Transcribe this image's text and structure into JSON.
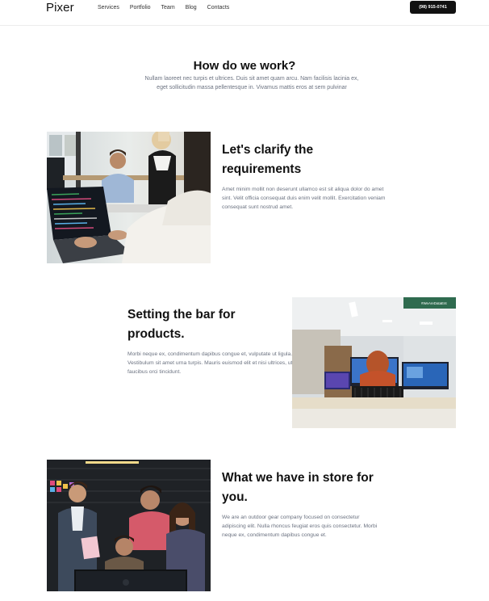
{
  "nav": {
    "logo": "Pixer",
    "links": [
      "Services",
      "Portfolio",
      "Team",
      "Blog",
      "Contacts"
    ],
    "phone": "(98) 915-0741"
  },
  "hero": {
    "title": "How do we work?",
    "subtitle": "Nullam laoreet nec turpis et ultrices. Duis sit amet quam arcu. Nam facilisis lacinia ex, eget sollicitudin massa pellentesque in. Vivamus mattis eros at sem pulvinar"
  },
  "sections": [
    {
      "title": "Let's clarify the requirements",
      "text": "Amet minim mollit non deserunt ullamco est sit aliqua dolor do amet sint. Velit officia consequat duis enim velit mollit. Exercitation veniam consequat sunt nostrud amet."
    },
    {
      "title": "Setting the bar for products.",
      "text": "Morbi neque ex, condimentum dapibus congue et, vulputate ut ligula. Vestibulum sit amet urna turpis. Mauris euismod elit et nisi ultrices, ut faucibus orci tincidunt."
    },
    {
      "title": "What we have in store for you.",
      "text": "We are an outdoor gear company focused on consectetur adipiscing elit. Nulla rhoncus feugiat eros quis consectetur. Morbi neque ex, condimentum dapibus congue et."
    }
  ],
  "photo_sign": "#WeAreDataEnt"
}
